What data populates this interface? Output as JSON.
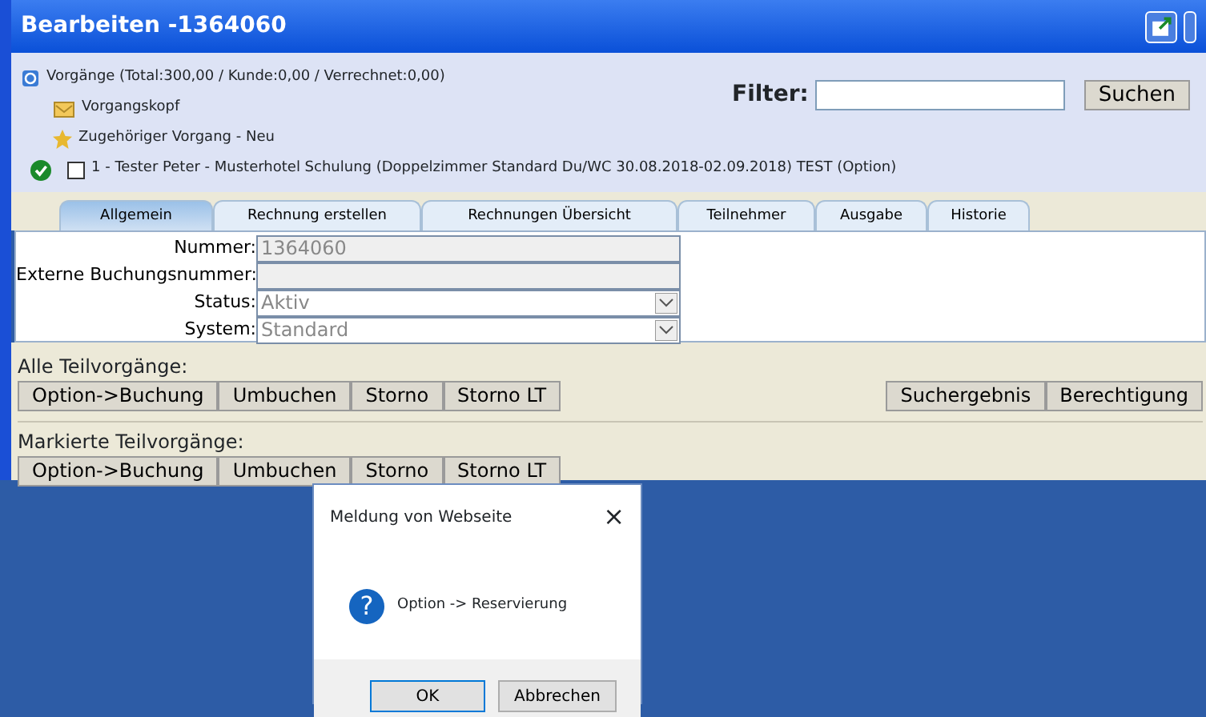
{
  "window": {
    "title": "Bearbeiten -1364060"
  },
  "tree": {
    "root": "Vorgänge (Total:300,00 / Kunde:0,00 / Verrechnet:0,00)",
    "items": [
      {
        "kind": "folder",
        "label": "Vorgangskopf"
      },
      {
        "kind": "star",
        "label": "Zugehöriger Vorgang - Neu"
      },
      {
        "kind": "check",
        "label": "1 - Tester Peter - Musterhotel Schulung (Doppelzimmer Standard Du/WC 30.08.2018-02.09.2018) TEST (Option)",
        "checked": false
      }
    ]
  },
  "filter": {
    "label": "Filter:",
    "button": "Suchen"
  },
  "tabs": [
    {
      "label": "Allgemein",
      "selected": true
    },
    {
      "label": "Rechnung erstellen",
      "selected": false
    },
    {
      "label": "Rechnungen Übersicht",
      "selected": false
    },
    {
      "label": "Teilnehmer",
      "selected": false
    },
    {
      "label": "Ausgabe",
      "selected": false
    },
    {
      "label": "Historie",
      "selected": false
    }
  ],
  "form": [
    {
      "kind": "text",
      "label": "Nummer:",
      "value": "1364060"
    },
    {
      "kind": "text",
      "label": "Externe Buchungsnummer:"
    },
    {
      "kind": "select",
      "label": "Status:",
      "value": "Aktiv"
    },
    {
      "kind": "select",
      "label": "System:",
      "value": "Standard"
    }
  ],
  "all_parts": {
    "label": "Alle Teilvorgänge:",
    "buttons": [
      "Option->Buchung",
      "Umbuchen",
      "Storno",
      "Storno LT"
    ],
    "right_buttons": [
      "Suchergebnis",
      "Berechtigung"
    ]
  },
  "marked_parts": {
    "label": "Markierte Teilvorgänge:",
    "buttons": [
      "Option->Buchung",
      "Umbuchen",
      "Storno",
      "Storno LT"
    ]
  },
  "dialog": {
    "title": "Meldung von Webseite",
    "close": "×",
    "icon": "?",
    "message": "Option -> Reservierung",
    "buttons": [
      "OK",
      "Abbrechen"
    ]
  }
}
